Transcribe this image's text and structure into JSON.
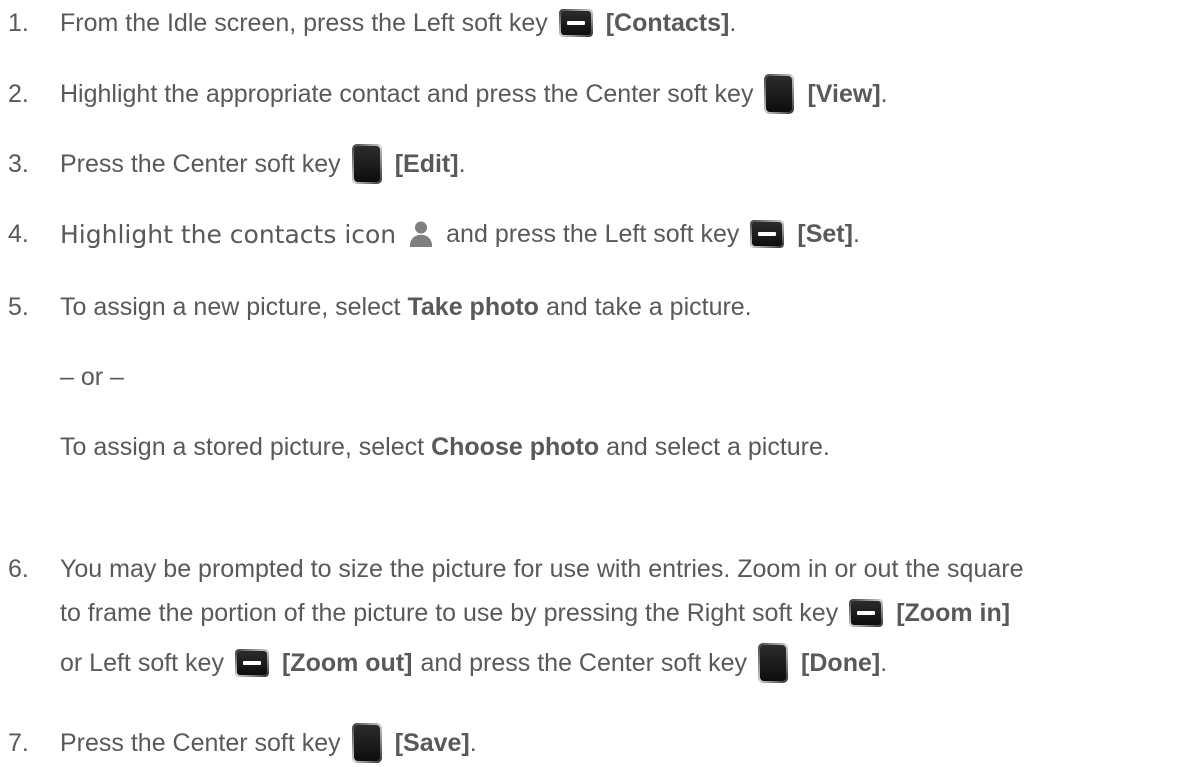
{
  "steps": [
    {
      "number": "1.",
      "before": "From the Idle screen, press the Left soft key",
      "key_icon": "left-soft-key-icon",
      "key_label": "[Contacts]",
      "after": "."
    },
    {
      "number": "2.",
      "before": "Highlight the appropriate contact and press the Center soft key",
      "key_icon": "center-soft-key-icon",
      "key_label": "[View]",
      "after": "."
    },
    {
      "number": "3.",
      "before": "Press the Center soft key",
      "key_icon": "center-soft-key-icon",
      "key_label": "[Edit]",
      "after": "."
    },
    {
      "number": "4.",
      "before": "Highlight the contacts icon",
      "contact_icon": "contacts-person-icon",
      "middle": "and press the Left soft key",
      "key_icon": "left-soft-key-icon",
      "key_label": "[Set]",
      "after": "."
    },
    {
      "number": "5.",
      "line1_before": "To assign a new picture, select",
      "line1_bold": "Take photo",
      "line1_after": "and take a picture.",
      "or_text": "– or –",
      "line2_before": "To assign a stored picture, select",
      "line2_bold": "Choose photo",
      "line2_after": "and select a picture."
    },
    {
      "number": "6.",
      "line1": "You may be prompted to size the picture for use with entries. Zoom in or out the square",
      "line2_before": "to frame the portion of the picture to use by pressing the Right soft key",
      "line2_key_icon": "right-soft-key-icon",
      "line2_key_label": "[Zoom in]",
      "line3_before": "or Left soft key",
      "line3_key1_icon": "left-soft-key-icon",
      "line3_key1_label": "[Zoom out]",
      "line3_middle": "and press the Center soft key",
      "line3_key2_icon": "center-soft-key-icon",
      "line3_key2_label": "[Done]",
      "line3_after": "."
    },
    {
      "number": "7.",
      "before": "Press the Center soft key",
      "key_icon": "center-soft-key-icon",
      "key_label": "[Save]",
      "after": "."
    }
  ],
  "colors": {
    "text": "#595959",
    "key_dark": "#1a1a1a",
    "key_light": "#bfbfbf",
    "person_icon": "#7f7f7f"
  }
}
